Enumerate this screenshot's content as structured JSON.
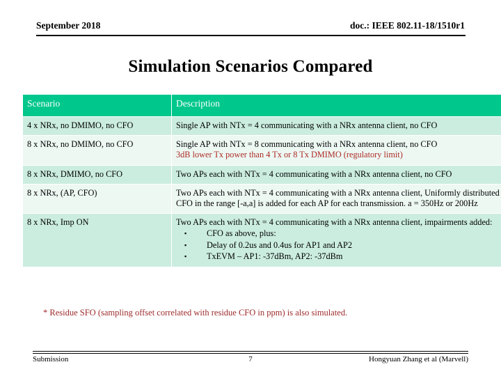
{
  "header": {
    "left": "September 2018",
    "right": "doc.: IEEE 802.11-18/1510r1"
  },
  "title": "Simulation Scenarios Compared",
  "table": {
    "columns": [
      "Scenario",
      "Description"
    ],
    "header_bg": "#00C78C",
    "header_text_color": "#FFFFFF",
    "row_bg_a": "#CBEDE0",
    "row_bg_b": "#EDF8F3",
    "highlight_color": "#AE2B25",
    "rows": [
      {
        "scenario": "4 x NRx, no DMIMO, no CFO",
        "lines": [
          "Single AP with NTx = 4 communicating with a NRx antenna client, no CFO"
        ],
        "red_lines": [],
        "bullets": []
      },
      {
        "scenario": "8 x NRx, no DMIMO, no CFO",
        "lines": [
          "Single AP with NTx = 8 communicating with a NRx antenna client, no CFO"
        ],
        "red_lines": [
          "3dB lower Tx power than 4 Tx or 8 Tx DMIMO (regulatory limit)"
        ],
        "bullets": []
      },
      {
        "scenario": "8 x NRx, DMIMO, no CFO",
        "lines": [
          "Two APs each with NTx = 4 communicating with a NRx antenna client, no CFO"
        ],
        "red_lines": [],
        "bullets": []
      },
      {
        "scenario": "8 x NRx, (AP, CFO)",
        "lines": [
          "Two APs each with NTx = 4 communicating with a NRx antenna client, Uniformly distributed CFO in the range [-a,a] is added for each AP for each transmission. a = 350Hz or 200Hz"
        ],
        "red_lines": [],
        "bullets": []
      },
      {
        "scenario": "8 x NRx, Imp ON",
        "lines": [
          "Two APs each with NTx = 4 communicating with a NRx antenna client, impairments added:"
        ],
        "red_lines": [],
        "bullets": [
          "CFO as above, plus:",
          "Delay of 0.2us and 0.4us for AP1 and AP2",
          "TxEVM – AP1: -37dBm, AP2: -37dBm"
        ]
      }
    ]
  },
  "footnote": "* Residue SFO (sampling offset correlated with residue CFO in ppm) is also simulated.",
  "footer": {
    "left": "Submission",
    "page": "7",
    "right": "Hongyuan Zhang et al (Marvell)"
  },
  "icons": {
    "bullet": "▪"
  }
}
